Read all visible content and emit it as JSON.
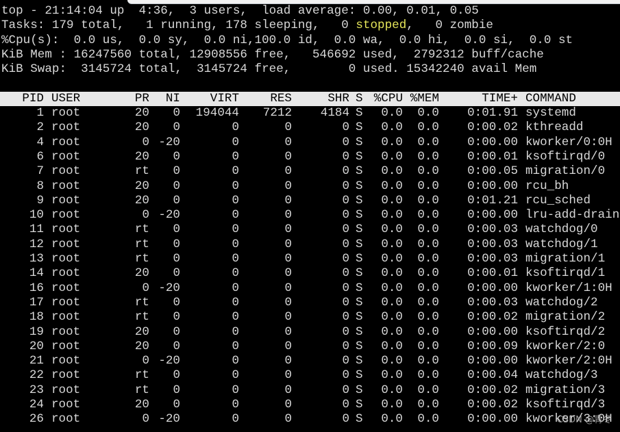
{
  "summary": {
    "line1": "top - 21:14:04 up  4:36,  3 users,  load average: 0.00, 0.01, 0.05",
    "line2_pre": "Tasks: 179 total,   1 running, 178 sleeping,   0 ",
    "line2_stopped": "stopped",
    "line2_post": ",   0 zombie",
    "line3": "%Cpu(s):  0.0 us,  0.0 sy,  0.0 ni,100.0 id,  0.0 wa,  0.0 hi,  0.0 si,  0.0 st",
    "line4": "KiB Mem : 16247560 total, 12908556 free,   546692 used,  2792312 buff/cache",
    "line5": "KiB Swap:  3145724 total,  3145724 free,        0 used. 15342240 avail Mem"
  },
  "table": {
    "headers": [
      "PID",
      "USER",
      "PR",
      "NI",
      "VIRT",
      "RES",
      "SHR",
      "S",
      "%CPU",
      "%MEM",
      "TIME+",
      "COMMAND"
    ],
    "rows": [
      [
        "1",
        "root",
        "20",
        "0",
        "194044",
        "7212",
        "4184",
        "S",
        "0.0",
        "0.0",
        "0:01.91",
        "systemd"
      ],
      [
        "2",
        "root",
        "20",
        "0",
        "0",
        "0",
        "0",
        "S",
        "0.0",
        "0.0",
        "0:00.02",
        "kthreadd"
      ],
      [
        "4",
        "root",
        "0",
        "-20",
        "0",
        "0",
        "0",
        "S",
        "0.0",
        "0.0",
        "0:00.00",
        "kworker/0:0H"
      ],
      [
        "6",
        "root",
        "20",
        "0",
        "0",
        "0",
        "0",
        "S",
        "0.0",
        "0.0",
        "0:00.01",
        "ksoftirqd/0"
      ],
      [
        "7",
        "root",
        "rt",
        "0",
        "0",
        "0",
        "0",
        "S",
        "0.0",
        "0.0",
        "0:00.05",
        "migration/0"
      ],
      [
        "8",
        "root",
        "20",
        "0",
        "0",
        "0",
        "0",
        "S",
        "0.0",
        "0.0",
        "0:00.00",
        "rcu_bh"
      ],
      [
        "9",
        "root",
        "20",
        "0",
        "0",
        "0",
        "0",
        "S",
        "0.0",
        "0.0",
        "0:01.21",
        "rcu_sched"
      ],
      [
        "10",
        "root",
        "0",
        "-20",
        "0",
        "0",
        "0",
        "S",
        "0.0",
        "0.0",
        "0:00.00",
        "lru-add-drain"
      ],
      [
        "11",
        "root",
        "rt",
        "0",
        "0",
        "0",
        "0",
        "S",
        "0.0",
        "0.0",
        "0:00.03",
        "watchdog/0"
      ],
      [
        "12",
        "root",
        "rt",
        "0",
        "0",
        "0",
        "0",
        "S",
        "0.0",
        "0.0",
        "0:00.03",
        "watchdog/1"
      ],
      [
        "13",
        "root",
        "rt",
        "0",
        "0",
        "0",
        "0",
        "S",
        "0.0",
        "0.0",
        "0:00.03",
        "migration/1"
      ],
      [
        "14",
        "root",
        "20",
        "0",
        "0",
        "0",
        "0",
        "S",
        "0.0",
        "0.0",
        "0:00.01",
        "ksoftirqd/1"
      ],
      [
        "16",
        "root",
        "0",
        "-20",
        "0",
        "0",
        "0",
        "S",
        "0.0",
        "0.0",
        "0:00.00",
        "kworker/1:0H"
      ],
      [
        "17",
        "root",
        "rt",
        "0",
        "0",
        "0",
        "0",
        "S",
        "0.0",
        "0.0",
        "0:00.03",
        "watchdog/2"
      ],
      [
        "18",
        "root",
        "rt",
        "0",
        "0",
        "0",
        "0",
        "S",
        "0.0",
        "0.0",
        "0:00.02",
        "migration/2"
      ],
      [
        "19",
        "root",
        "20",
        "0",
        "0",
        "0",
        "0",
        "S",
        "0.0",
        "0.0",
        "0:00.00",
        "ksoftirqd/2"
      ],
      [
        "20",
        "root",
        "20",
        "0",
        "0",
        "0",
        "0",
        "S",
        "0.0",
        "0.0",
        "0:00.09",
        "kworker/2:0"
      ],
      [
        "21",
        "root",
        "0",
        "-20",
        "0",
        "0",
        "0",
        "S",
        "0.0",
        "0.0",
        "0:00.00",
        "kworker/2:0H"
      ],
      [
        "22",
        "root",
        "rt",
        "0",
        "0",
        "0",
        "0",
        "S",
        "0.0",
        "0.0",
        "0:00.04",
        "watchdog/3"
      ],
      [
        "23",
        "root",
        "rt",
        "0",
        "0",
        "0",
        "0",
        "S",
        "0.0",
        "0.0",
        "0:00.02",
        "migration/3"
      ],
      [
        "24",
        "root",
        "20",
        "0",
        "0",
        "0",
        "0",
        "S",
        "0.0",
        "0.0",
        "0:00.02",
        "ksoftirqd/3"
      ],
      [
        "26",
        "root",
        "0",
        "-20",
        "0",
        "0",
        "0",
        "S",
        "0.0",
        "0.0",
        "0:00.00",
        "kworker/3:0H"
      ]
    ]
  },
  "colors": {
    "stopped_highlight": "#e6e65a",
    "header_bg": "#e8e8e8"
  },
  "watermark": "CSDN @青冬"
}
